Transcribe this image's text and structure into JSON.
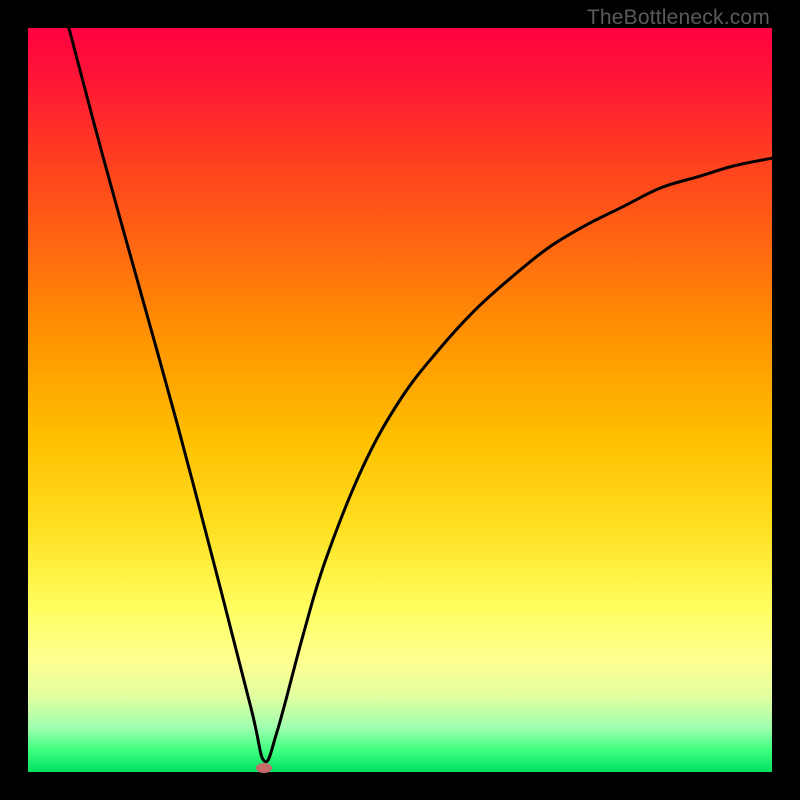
{
  "watermark": "TheBottleneck.com",
  "chart_data": {
    "type": "line",
    "title": "",
    "xlabel": "",
    "ylabel": "",
    "xlim": [
      0,
      1
    ],
    "ylim": [
      0,
      1
    ],
    "background_gradient": {
      "top": "#ff0040",
      "mid": "#ffbf00",
      "lower": "#ffff60",
      "bottom": "#00e060"
    },
    "series": [
      {
        "name": "bottleneck-curve",
        "description": "V-shaped curve descending from top-left to a minimum then rising asymptotically to the right",
        "x": [
          0.055,
          0.1,
          0.15,
          0.2,
          0.25,
          0.3,
          0.3175,
          0.335,
          0.37,
          0.4,
          0.45,
          0.5,
          0.55,
          0.6,
          0.65,
          0.7,
          0.75,
          0.8,
          0.85,
          0.9,
          0.95,
          1.0
        ],
        "y": [
          1.0,
          0.83,
          0.65,
          0.47,
          0.28,
          0.085,
          0.015,
          0.055,
          0.185,
          0.285,
          0.41,
          0.5,
          0.565,
          0.62,
          0.665,
          0.705,
          0.735,
          0.76,
          0.785,
          0.8,
          0.815,
          0.825
        ],
        "color": "#000000",
        "width": 3
      }
    ],
    "markers": [
      {
        "name": "optimal-point",
        "x": 0.3175,
        "y": 0.005,
        "color": "#c76a6a"
      }
    ]
  }
}
